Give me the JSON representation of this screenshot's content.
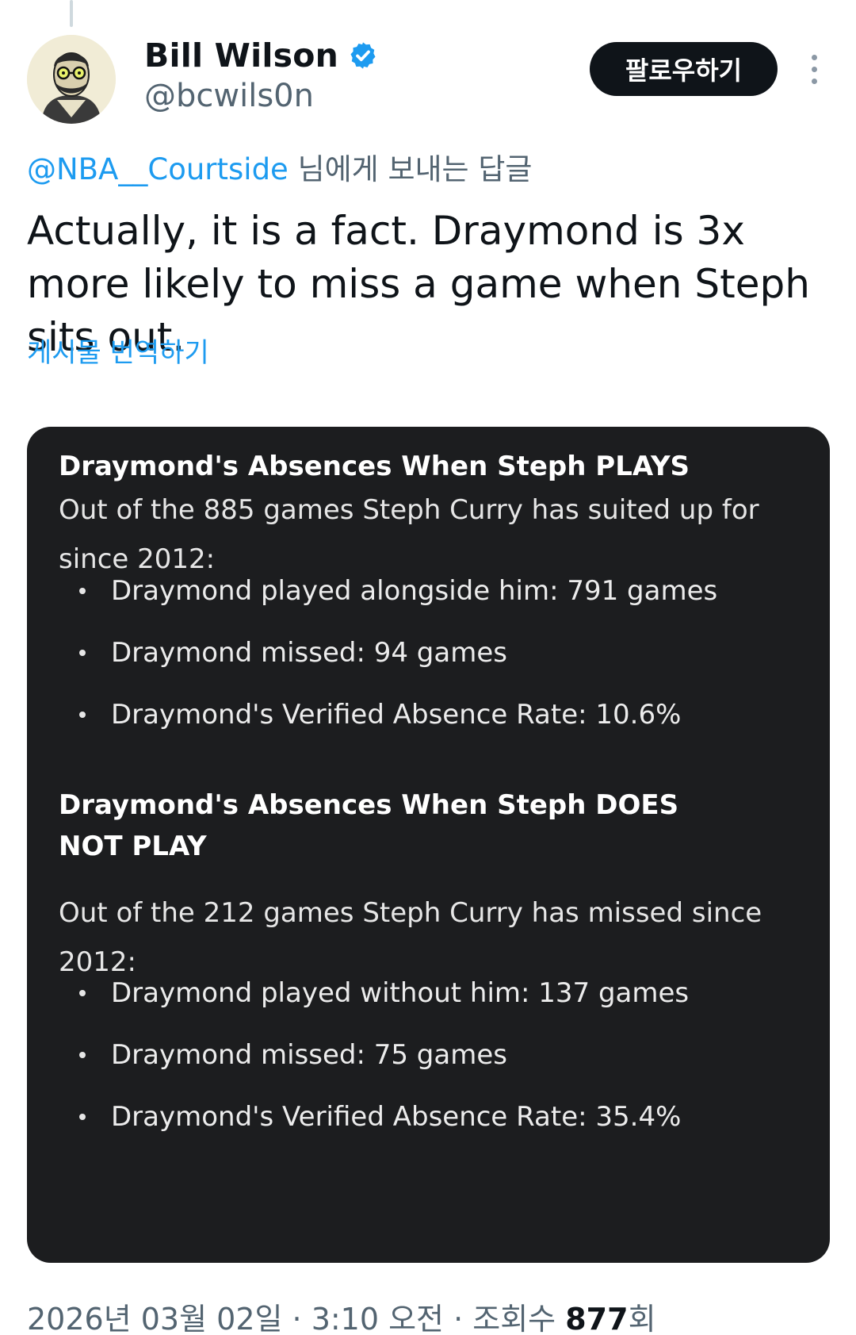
{
  "author": {
    "display_name": "Bill Wilson",
    "handle": "@bcwils0n",
    "verified_icon": "verified-badge-icon"
  },
  "actions": {
    "follow_label": "팔로우하기",
    "more_icon": "more-vertical-icon"
  },
  "reply_context": {
    "mention": "@NBA__Courtside",
    "suffix": " 님에게 보내는 답글"
  },
  "tweet": {
    "text": "Actually, it is a fact. Draymond is 3x more likely to miss a game when Steph sits out.",
    "translate_label": "게시물 번역하기"
  },
  "card": {
    "section1": {
      "heading": "Draymond's Absences When Steph PLAYS",
      "intro": "Out of the 885 games Steph Curry has suited up for since 2012:",
      "bullets": [
        "Draymond played alongside him: 791 games",
        "Draymond missed: 94 games",
        "Draymond's Verified Absence Rate: 10.6%"
      ]
    },
    "section2": {
      "heading": "Draymond's Absences When Steph DOES NOT PLAY",
      "intro": "Out of the 212 games Steph Curry has missed since 2012:",
      "bullets": [
        "Draymond played without him: 137 games",
        "Draymond missed: 75 games",
        "Draymond's Verified Absence Rate: 35.4%"
      ]
    }
  },
  "meta": {
    "timestamp": "2026년 03월 02일 · 3:10 오전 · 조회수 ",
    "views": "877",
    "views_suffix": "회"
  },
  "colors": {
    "accent": "#1d9bf0",
    "button_bg": "#0f1419",
    "card_bg": "#1c1d1f",
    "secondary_text": "#536471"
  }
}
